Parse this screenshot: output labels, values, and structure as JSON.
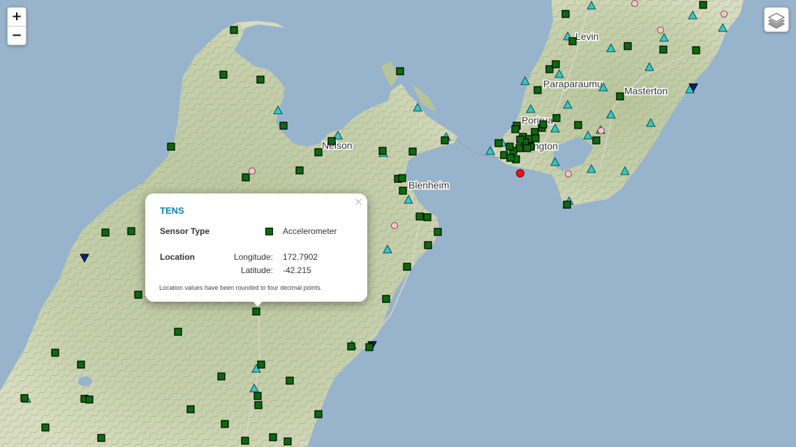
{
  "map": {
    "colors": {
      "sea": "#98b4cc",
      "land": "#c9d2b0",
      "land_shade": "#9fb184",
      "accelerometer": "#0b6b0b",
      "seismometer": "#34c9c6",
      "gnss": "#f6c3cb",
      "tide_gauge": "#0a1f8a",
      "selected": "#e8141c"
    },
    "places": [
      {
        "name": "Levin"
      },
      {
        "name": "Paraparaumu"
      },
      {
        "name": "Masterton"
      },
      {
        "name": "Porirua"
      },
      {
        "name": "Wellington",
        "visible_text": "ngton"
      },
      {
        "name": "Nelson",
        "visible_text": "Nelson"
      },
      {
        "name": "Blenheim"
      }
    ]
  },
  "controls": {
    "zoom_in": "+",
    "zoom_out": "−",
    "layers_icon": "layers-icon"
  },
  "popup": {
    "close": "×",
    "title": "TENS",
    "sensor_type_label": "Sensor Type",
    "sensor_type": "Accelerometer",
    "location_label": "Location",
    "longitude_label": "Longitude:",
    "longitude": "172.7902",
    "latitude_label": "Latitude:",
    "latitude": "-42.215",
    "note": "Location values have been rounded to four decimal points."
  }
}
